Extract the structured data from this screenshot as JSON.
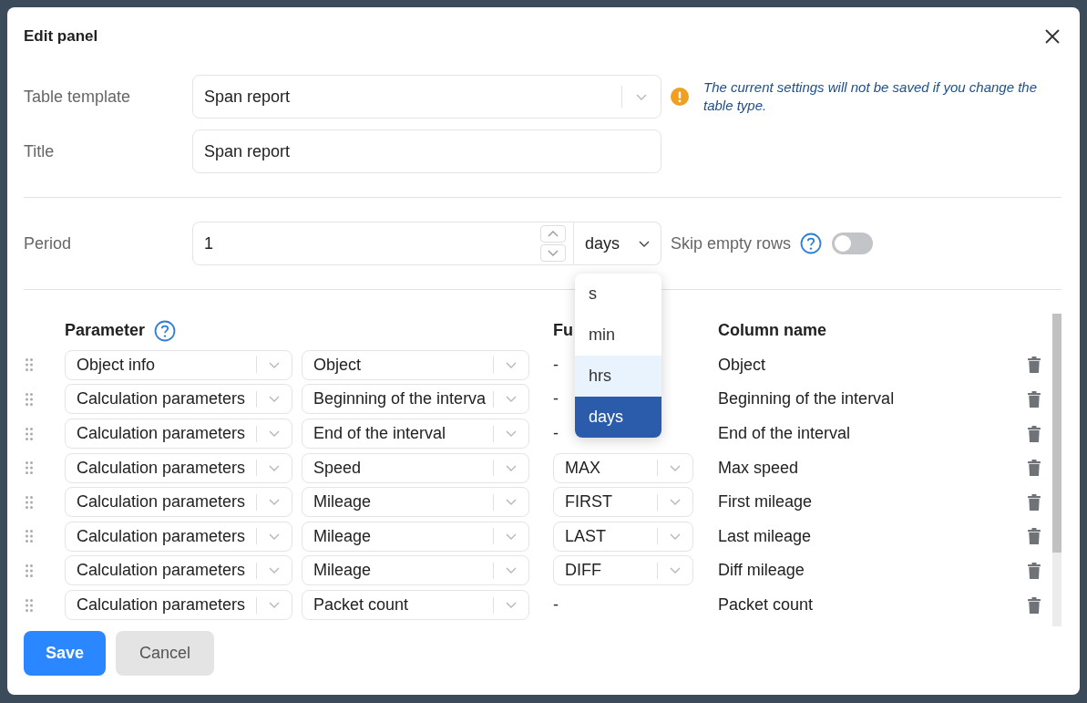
{
  "dialog": {
    "title": "Edit panel"
  },
  "form": {
    "table_template": {
      "label": "Table template",
      "value": "Span report"
    },
    "warning": "The current settings will not be saved if you change the table type.",
    "title": {
      "label": "Title",
      "value": "Span report"
    },
    "period": {
      "label": "Period",
      "value": "1",
      "unit": "days",
      "unit_menu": {
        "expanded": true,
        "options": [
          {
            "label": "s",
            "selected": false,
            "hovered": false
          },
          {
            "label": "min",
            "selected": false,
            "hovered": false
          },
          {
            "label": "hrs",
            "selected": false,
            "hovered": true
          },
          {
            "label": "days",
            "selected": true,
            "hovered": false
          }
        ]
      }
    },
    "skip_empty_rows": {
      "label": "Skip empty rows",
      "on": false
    }
  },
  "table": {
    "columns": [
      {
        "label": "Parameter",
        "help": true
      },
      {
        "label": "Fu"
      },
      {
        "label": "Column name"
      }
    ],
    "rows": [
      {
        "group": "Object info",
        "parameter": "Object",
        "function": {
          "kind": "text",
          "value": "-"
        },
        "column_name": "Object"
      },
      {
        "group": "Calculation parameters",
        "parameter": "Beginning of the interva",
        "function": {
          "kind": "text",
          "value": "-"
        },
        "column_name": "Beginning of the interval"
      },
      {
        "group": "Calculation parameters",
        "parameter": "End of the interval",
        "function": {
          "kind": "text",
          "value": "-"
        },
        "column_name": "End of the interval"
      },
      {
        "group": "Calculation parameters",
        "parameter": "Speed",
        "function": {
          "kind": "select",
          "value": "MAX"
        },
        "column_name": "Max speed"
      },
      {
        "group": "Calculation parameters",
        "parameter": "Mileage",
        "function": {
          "kind": "select",
          "value": "FIRST"
        },
        "column_name": "First mileage"
      },
      {
        "group": "Calculation parameters",
        "parameter": "Mileage",
        "function": {
          "kind": "select",
          "value": "LAST"
        },
        "column_name": "Last mileage"
      },
      {
        "group": "Calculation parameters",
        "parameter": "Mileage",
        "function": {
          "kind": "select",
          "value": "DIFF"
        },
        "column_name": "Diff mileage"
      },
      {
        "group": "Calculation parameters",
        "parameter": "Packet count",
        "function": {
          "kind": "text",
          "value": "-"
        },
        "column_name": "Packet count"
      }
    ]
  },
  "buttons": [
    {
      "label": "Save",
      "kind": "primary"
    },
    {
      "label": "Cancel",
      "kind": "secondary"
    }
  ]
}
